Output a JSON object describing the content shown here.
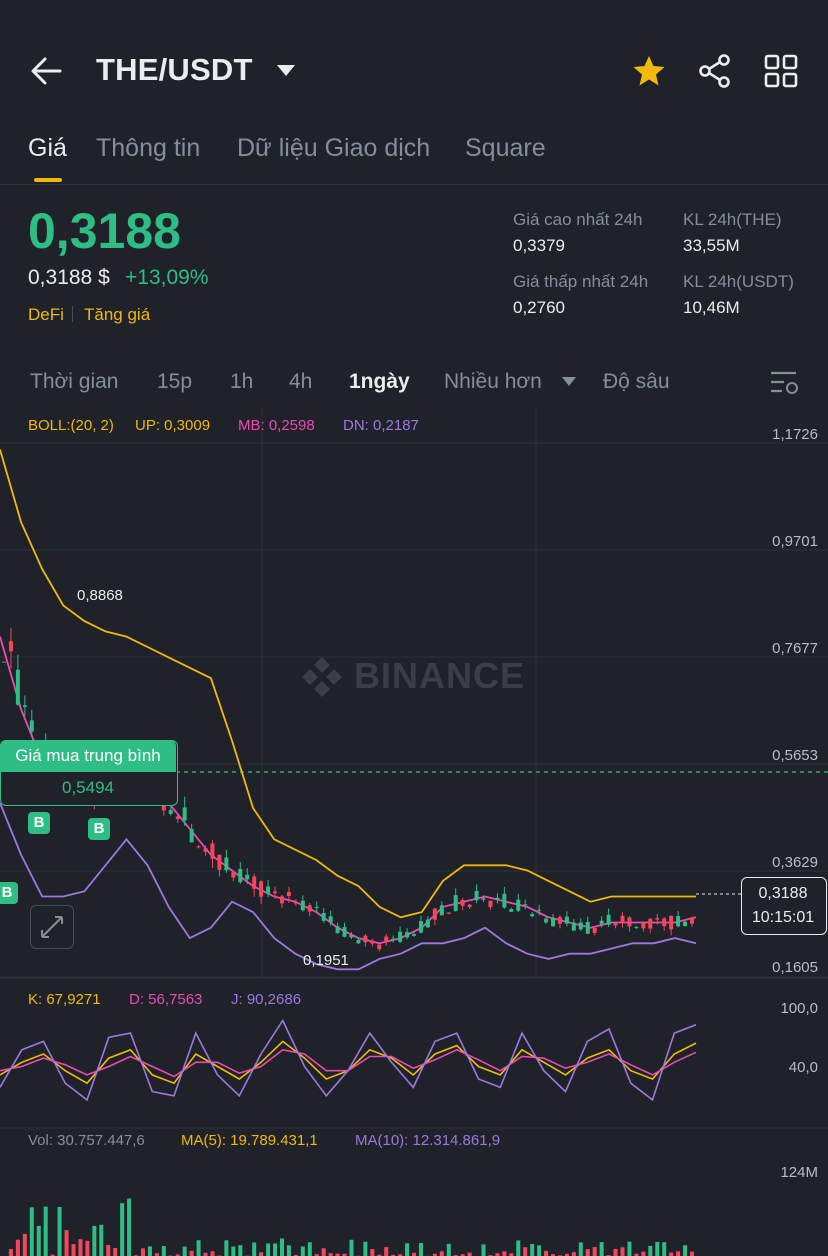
{
  "header": {
    "pair": "THE/USDT",
    "icons": [
      "back-arrow-icon",
      "dropdown-caret-icon",
      "star-icon",
      "share-icon",
      "grid-icon"
    ],
    "star_color": "#f0b90b"
  },
  "tabs": [
    {
      "label": "Giá",
      "active": true
    },
    {
      "label": "Thông tin",
      "active": false
    },
    {
      "label": "Dữ liệu Giao dịch",
      "active": false
    },
    {
      "label": "Square",
      "active": false
    }
  ],
  "price": {
    "last": "0,3188",
    "usd": "0,3188 $",
    "change": "+13,09%",
    "tags": [
      "DeFi",
      "Tăng giá"
    ],
    "up_color": "#2ebd85"
  },
  "stats": {
    "high_label": "Giá cao nhất 24h",
    "high_value": "0,3379",
    "low_label": "Giá thấp nhất 24h",
    "low_value": "0,2760",
    "vol_the_label": "KL 24h(THE)",
    "vol_the_value": "33,55M",
    "vol_usdt_label": "KL 24h(USDT)",
    "vol_usdt_value": "10,46M"
  },
  "intervals": {
    "items": [
      "Thời gian",
      "15p",
      "1h",
      "4h",
      "1ngày",
      "Nhiều hơn",
      "Độ sâu"
    ],
    "active": "1ngày"
  },
  "chart_data": [
    {
      "type": "line",
      "title": "",
      "indicator": "BOLL:(20, 2)",
      "legend": [
        "BOLL:(20, 2)",
        "UP: 0,3009",
        "MB: 0,2598",
        "DN: 0,2187"
      ],
      "y_ticks": [
        "1,1726",
        "0,9701",
        "0,7677",
        "0,5653",
        "0,3629",
        "0,1605"
      ],
      "ylim": [
        0.1605,
        1.1726
      ],
      "annotations": {
        "high": "0,8868",
        "low": "0,1951",
        "avg_buy_title": "Giá mua trung bình",
        "avg_buy_value": "0,5494",
        "buy_marker": "B",
        "current_price": "0,3188",
        "countdown": "10:15:01",
        "watermark": "BINANCE"
      },
      "series": [
        {
          "name": "UP",
          "color": "#f0b90b",
          "values": [
            1.16,
            1.02,
            0.93,
            0.86,
            0.83,
            0.81,
            0.8,
            0.78,
            0.76,
            0.74,
            0.72,
            0.6,
            0.47,
            0.41,
            0.39,
            0.37,
            0.34,
            0.32,
            0.28,
            0.26,
            0.27,
            0.33,
            0.36,
            0.36,
            0.36,
            0.35,
            0.33,
            0.31,
            0.29,
            0.3,
            0.3,
            0.3,
            0.3,
            0.3
          ]
        },
        {
          "name": "MB",
          "color": "#e94bb3",
          "values": [
            0.8,
            0.66,
            0.56,
            0.52,
            0.5,
            0.52,
            0.54,
            0.52,
            0.48,
            0.43,
            0.38,
            0.35,
            0.32,
            0.3,
            0.29,
            0.27,
            0.24,
            0.22,
            0.21,
            0.22,
            0.24,
            0.28,
            0.29,
            0.3,
            0.29,
            0.28,
            0.26,
            0.25,
            0.24,
            0.25,
            0.25,
            0.25,
            0.25,
            0.26
          ]
        },
        {
          "name": "DN",
          "color": "#9e77e0",
          "values": [
            0.48,
            0.38,
            0.3,
            0.3,
            0.31,
            0.36,
            0.41,
            0.36,
            0.28,
            0.22,
            0.24,
            0.29,
            0.27,
            0.22,
            0.19,
            0.17,
            0.16,
            0.16,
            0.18,
            0.19,
            0.21,
            0.21,
            0.22,
            0.24,
            0.21,
            0.19,
            0.18,
            0.19,
            0.19,
            0.2,
            0.21,
            0.21,
            0.22,
            0.21
          ]
        }
      ]
    },
    {
      "type": "line",
      "title": "",
      "legend": [
        "K: 67,9271",
        "D: 56,7563",
        "J: 90,2686"
      ],
      "y_ticks": [
        "100,0",
        "40,0"
      ],
      "ylim": [
        -30,
        110
      ],
      "series": [
        {
          "name": "K",
          "color": "#f0b90b",
          "values": [
            30,
            45,
            55,
            35,
            20,
            50,
            60,
            30,
            20,
            55,
            40,
            25,
            45,
            70,
            50,
            25,
            35,
            60,
            50,
            30,
            55,
            65,
            40,
            30,
            60,
            45,
            30,
            50,
            60,
            35,
            25,
            55,
            68
          ]
        },
        {
          "name": "D",
          "color": "#e94bb3",
          "values": [
            35,
            40,
            50,
            42,
            30,
            40,
            52,
            40,
            28,
            45,
            45,
            32,
            40,
            60,
            55,
            35,
            35,
            52,
            52,
            38,
            48,
            60,
            48,
            35,
            52,
            50,
            38,
            45,
            55,
            42,
            30,
            45,
            57
          ]
        },
        {
          "name": "J",
          "color": "#9e77e0",
          "values": [
            15,
            60,
            70,
            20,
            0,
            75,
            80,
            10,
            5,
            80,
            30,
            5,
            55,
            95,
            40,
            5,
            35,
            80,
            45,
            15,
            70,
            80,
            25,
            15,
            80,
            35,
            10,
            70,
            85,
            20,
            0,
            80,
            90
          ]
        }
      ]
    },
    {
      "type": "bar",
      "title": "",
      "legend": [
        "Vol: 30.757.447,6",
        "MA(5): 19.789.431,1",
        "MA(10): 12.314.861,9"
      ],
      "y_ticks": [
        "124M"
      ],
      "ylim": [
        0,
        124
      ]
    }
  ]
}
